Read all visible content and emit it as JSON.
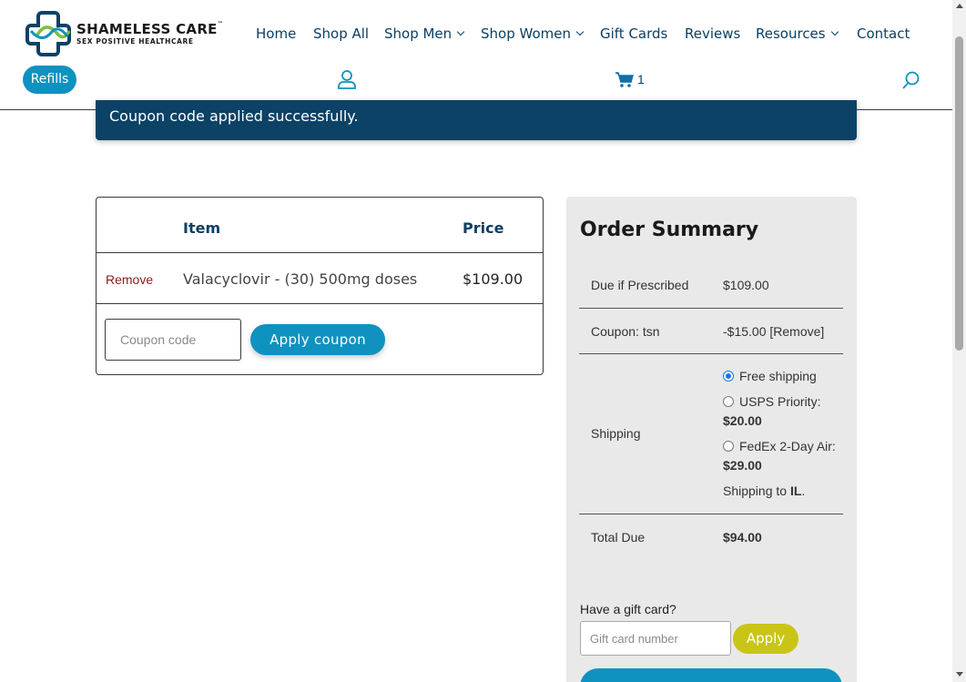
{
  "header": {
    "logo_main": "SHAMELESS CARE",
    "logo_tm": "™",
    "logo_sub": "SEX POSITIVE HEALTHCARE",
    "nav": [
      {
        "label": "Home",
        "dropdown": false
      },
      {
        "label": "Shop All",
        "dropdown": false
      },
      {
        "label": "Shop Men",
        "dropdown": true
      },
      {
        "label": "Shop Women",
        "dropdown": true
      },
      {
        "label": "Gift Cards",
        "dropdown": false
      },
      {
        "label": "Reviews",
        "dropdown": false
      },
      {
        "label": "Resources",
        "dropdown": true
      },
      {
        "label": "Contact",
        "dropdown": false
      }
    ],
    "refills_label": "Refills",
    "cart_count": "1",
    "icons": {
      "user": "user-icon",
      "cart": "cart-icon",
      "search": "search-icon"
    }
  },
  "notice": {
    "message": "Coupon code applied successfully."
  },
  "cart": {
    "col_item": "Item",
    "col_price": "Price",
    "rows": [
      {
        "remove": "Remove",
        "name": "Valacyclovir - (30) 500mg doses",
        "price": "$109.00"
      }
    ],
    "coupon_placeholder": "Coupon code",
    "apply_coupon": "Apply coupon"
  },
  "summary": {
    "title": "Order Summary",
    "due_label": "Due if Prescribed",
    "due_value": "$109.00",
    "coupon_label": "Coupon: tsn",
    "coupon_value": "-$15.00",
    "coupon_remove": "[Remove]",
    "shipping_label": "Shipping",
    "shipping_options": [
      {
        "name": "Free shipping",
        "price": "",
        "checked": true
      },
      {
        "name": "USPS Priority:",
        "price": "$20.00",
        "checked": false
      },
      {
        "name": "FedEx 2-Day Air:",
        "price": "$29.00",
        "checked": false
      }
    ],
    "shipping_to_prefix": "Shipping to",
    "shipping_to_state": "IL",
    "total_label": "Total Due",
    "total_value": "$94.00",
    "gift_label": "Have a gift card?",
    "gift_placeholder": "Gift card number",
    "gift_apply": "Apply"
  },
  "colors": {
    "brand_blue": "#0f92c0",
    "navy": "#0b4266",
    "gift_yellow": "#c9c516",
    "remove_red": "#8b1a1a"
  }
}
